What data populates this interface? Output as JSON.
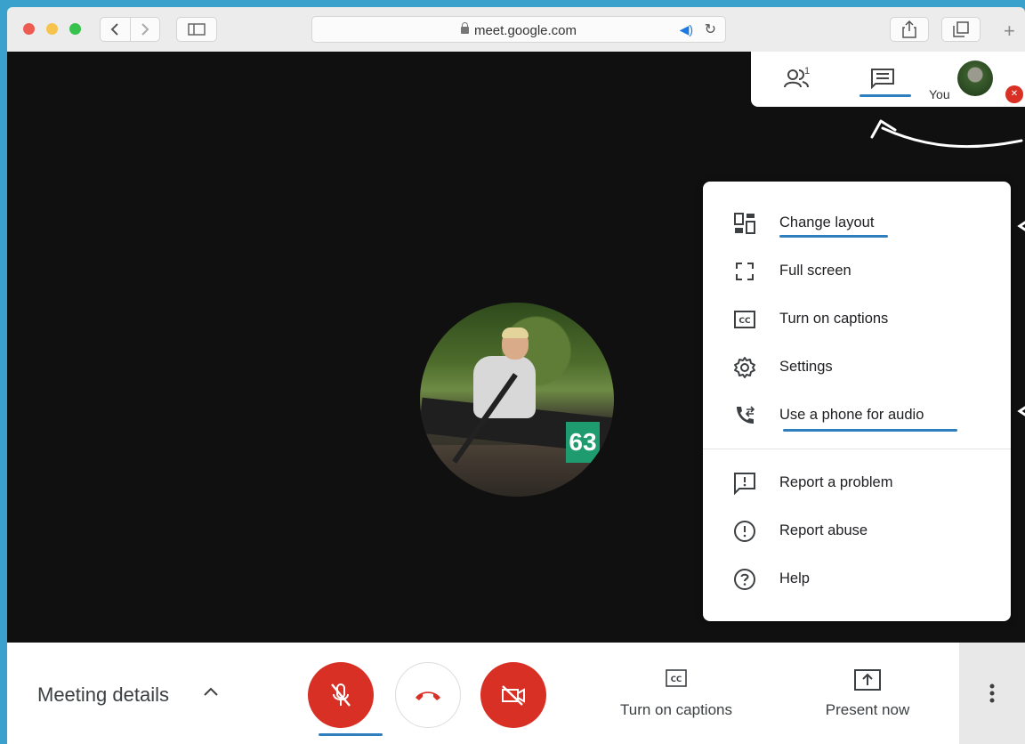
{
  "browser": {
    "url": "meet.google.com"
  },
  "top_panel": {
    "people_count": "1",
    "you_label": "You"
  },
  "menu": {
    "items": [
      {
        "label": "Change layout",
        "icon": "layout-icon"
      },
      {
        "label": "Full screen",
        "icon": "fullscreen-icon"
      },
      {
        "label": "Turn on captions",
        "icon": "captions-icon"
      },
      {
        "label": "Settings",
        "icon": "gear-icon"
      },
      {
        "label": "Use a phone for audio",
        "icon": "phone-audio-icon"
      },
      {
        "label": "Report a problem",
        "icon": "report-problem-icon"
      },
      {
        "label": "Report abuse",
        "icon": "report-abuse-icon"
      },
      {
        "label": "Help",
        "icon": "help-icon"
      }
    ]
  },
  "photo": {
    "boat_number": "63"
  },
  "bottom_bar": {
    "meeting_details": "Meeting details",
    "captions_label": "Turn on captions",
    "present_label": "Present now"
  },
  "colors": {
    "background": "#3aa0cc",
    "red_button": "#d93025",
    "annotation_blue": "#2f7fbf"
  }
}
